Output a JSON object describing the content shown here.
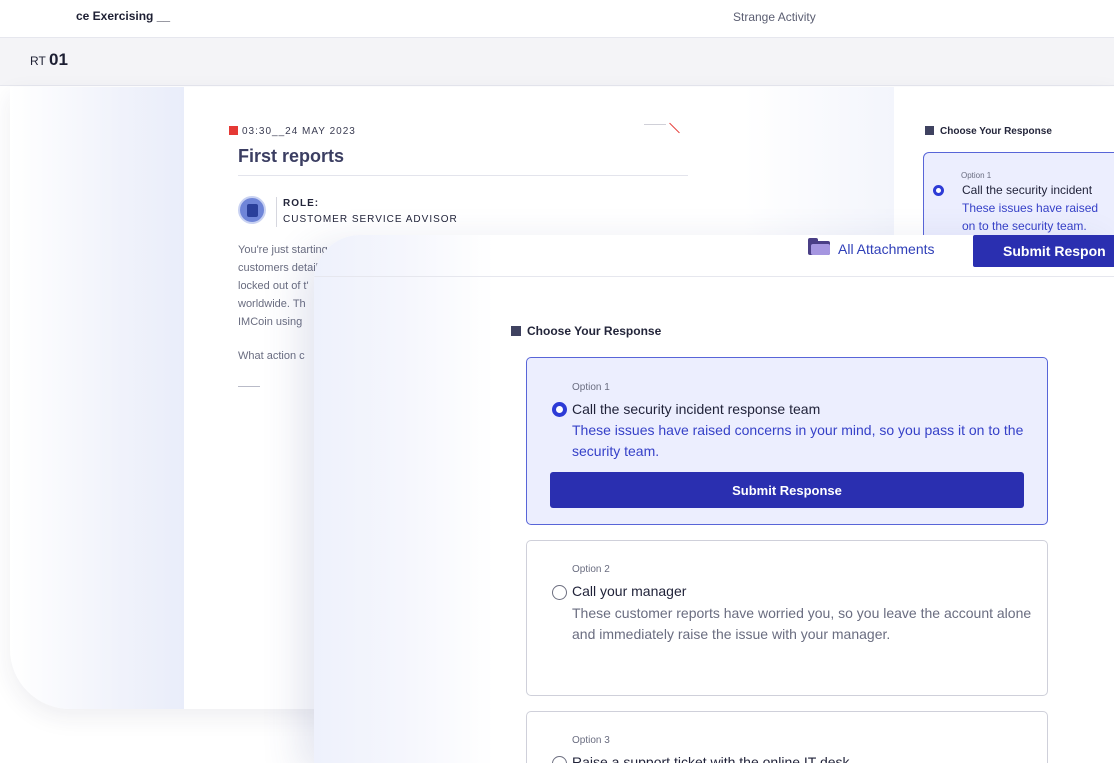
{
  "background": {
    "breadcrumb": "ce Exercising __",
    "scenario_title": "Strange Activity",
    "part_label": "RT",
    "part_number": "01",
    "timestamp": "03:30__24 MAY 2023",
    "report_title": "First reports",
    "role_label": "ROLE:",
    "role_value": "CUSTOMER SERVICE ADVISOR",
    "story_lines": [
      "You're just starting w",
      "customers detail",
      "locked out of t'",
      "worldwide. Th",
      "IMCoin using"
    ],
    "story_question": "What action c",
    "choose_heading": "Choose Your Response",
    "option": {
      "label": "Option 1",
      "title": "Call the security incident",
      "desc_line1": "These issues have raised",
      "desc_line2": "on to the security team."
    }
  },
  "foreground": {
    "attachments_label": "All Attachments",
    "submit_top_label": "Submit Respon",
    "choose_heading": "Choose Your Response",
    "options": [
      {
        "label": "Option 1",
        "title": "Call the security incident response team",
        "description": "These issues have raised concerns in your mind, so you pass it on to the security team.",
        "selected": true,
        "submit_label": "Submit Response"
      },
      {
        "label": "Option 2",
        "title": "Call your manager",
        "description": "These customer reports have worried you, so you leave the account alone and immediately raise the issue with your manager.",
        "selected": false
      },
      {
        "label": "Option 3",
        "title": "Raise a support ticket with the online IT desk",
        "selected": false
      }
    ]
  },
  "colors": {
    "accent": "#2a2fb0",
    "selected_bg": "#eceefe",
    "timestamp_marker": "#e53935"
  }
}
